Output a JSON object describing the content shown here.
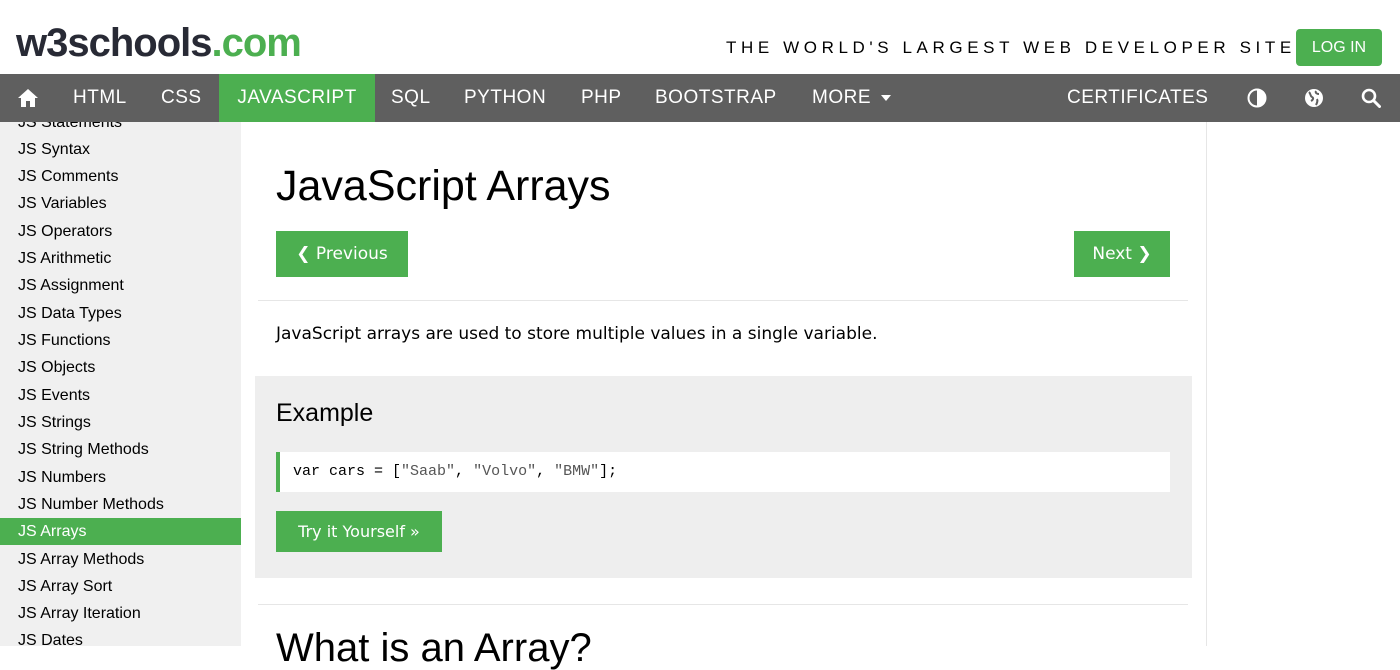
{
  "header": {
    "logo_w3": "w3schools",
    "logo_dotcom": ".com",
    "tagline": "THE WORLD'S LARGEST WEB DEVELOPER SITE",
    "login_label": "LOG IN"
  },
  "nav": {
    "items": [
      "HTML",
      "CSS",
      "JAVASCRIPT",
      "SQL",
      "PYTHON",
      "PHP",
      "BOOTSTRAP",
      "MORE"
    ],
    "active": "JAVASCRIPT",
    "certificates": "CERTIFICATES",
    "icons": [
      "home-icon",
      "chevron-down-icon",
      "contrast-icon",
      "globe-icon",
      "search-icon"
    ]
  },
  "sidebar": {
    "items": [
      "JS Statements",
      "JS Syntax",
      "JS Comments",
      "JS Variables",
      "JS Operators",
      "JS Arithmetic",
      "JS Assignment",
      "JS Data Types",
      "JS Functions",
      "JS Objects",
      "JS Events",
      "JS Strings",
      "JS String Methods",
      "JS Numbers",
      "JS Number Methods",
      "JS Arrays",
      "JS Array Methods",
      "JS Array Sort",
      "JS Array Iteration",
      "JS Dates"
    ],
    "active": "JS Arrays"
  },
  "main": {
    "title": "JavaScript Arrays",
    "prev_label": "❮ Previous",
    "next_label": "Next ❯",
    "intro": "JavaScript arrays are used to store multiple values in a single variable.",
    "example": {
      "title": "Example",
      "code_prefix": "var cars = [",
      "code_s1": "\"Saab\"",
      "code_sep1": ", ",
      "code_s2": "\"Volvo\"",
      "code_sep2": ", ",
      "code_s3": "\"BMW\"",
      "code_suffix": "];",
      "try_label": "Try it Yourself »"
    },
    "next_heading": "What is an Array?"
  },
  "colors": {
    "accent": "#4CAF50",
    "nav_bg": "#5f5f5f",
    "sidebar_bg": "#f0f0f0",
    "example_bg": "#eeeeee"
  }
}
